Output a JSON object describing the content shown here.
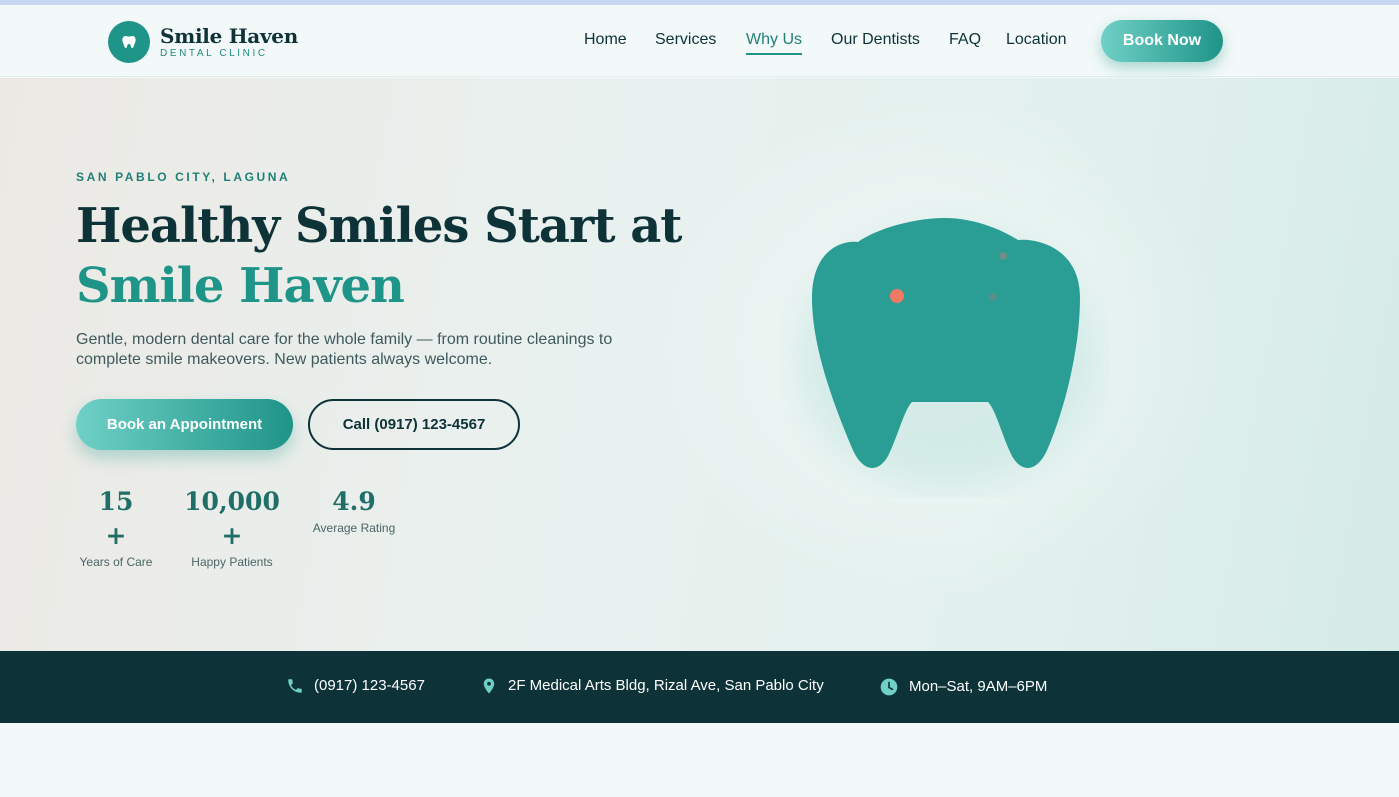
{
  "brand": {
    "name": "Smile Haven",
    "tagline": "DENTAL CLINIC",
    "colors": {
      "primary": "#1f9488",
      "dark": "#0d3338",
      "accent_light": "#6fd0c6",
      "dot": "#f07a63"
    }
  },
  "nav": {
    "items": [
      {
        "label": "Home"
      },
      {
        "label": "Services"
      },
      {
        "label": "Why Us",
        "active": true
      },
      {
        "label": "Our Dentists"
      },
      {
        "label": "FAQ"
      },
      {
        "label": "Location"
      }
    ],
    "cta_label": "Book Now"
  },
  "hero": {
    "eyebrow": "SAN PABLO CITY, LAGUNA",
    "headline_line1": "Healthy Smiles Start at",
    "headline_line2": "Smile Haven",
    "subtext": "Gentle, modern dental care for the whole family — from routine cleanings to complete smile makeovers. New patients always welcome.",
    "primary_button": "Book an Appointment",
    "secondary_button": "Call (0917) 123-4567",
    "illustration_icon": "tooth-icon",
    "stats": [
      {
        "value": "15",
        "suffix": "+",
        "label": "Years of Care"
      },
      {
        "value": "10,000",
        "suffix": "+",
        "label": "Happy Patients"
      },
      {
        "value": "4.9",
        "label": "Average Rating"
      }
    ]
  },
  "infobar": {
    "phone": {
      "icon": "phone-icon",
      "text": "(0917) 123-4567"
    },
    "address": {
      "icon": "location-pin-icon",
      "text": "2F Medical Arts Bldg, Rizal Ave, San Pablo City"
    },
    "hours": {
      "icon": "clock-icon",
      "text": "Mon–Sat, 9AM–6PM"
    }
  }
}
